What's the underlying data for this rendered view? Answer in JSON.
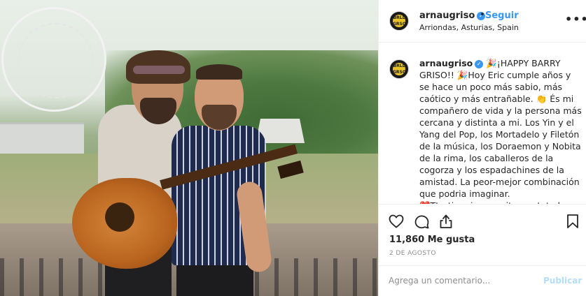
{
  "post": {
    "username": "arnaugriso",
    "verified_glyph": "✓",
    "header_dot": "•",
    "follow_label": "Seguir",
    "location": "Arriondas, Asturias, Spain",
    "more_label": "•••",
    "avatar_text": "BRLL GRSO",
    "caption_user": "arnaugriso",
    "caption_text": " 🎉¡HAPPY BARRY GRISO!! 🎉Hoy Eric cumple años y se hace un poco más sabio, más caótico y más entrañable. 👏 És mi compañero de vida y la persona más cercana y distinta a mi. Los Yin y el Yang del Pop, los Mortadelo y Filetón de la música, los Doraemon y Nobita de la rima, los caballeros de la cogorza y los espadachines de la amistad. La peor-mejor combinación que podria imaginar.\n❤️T'estimo i necessito per tota la",
    "likes": "11,860 Me gusta",
    "date": "2 DE AGOSTO",
    "comment_placeholder": "Agrega un comentario...",
    "post_button": "Publicar"
  },
  "icons": {
    "like": "heart-icon",
    "comment": "speech-bubble-icon",
    "share": "share-icon",
    "save": "bookmark-icon"
  },
  "colors": {
    "accent": "#3897f0",
    "post_disabled": "#b2dffc",
    "muted": "#8e8e8e",
    "text": "#262626"
  }
}
